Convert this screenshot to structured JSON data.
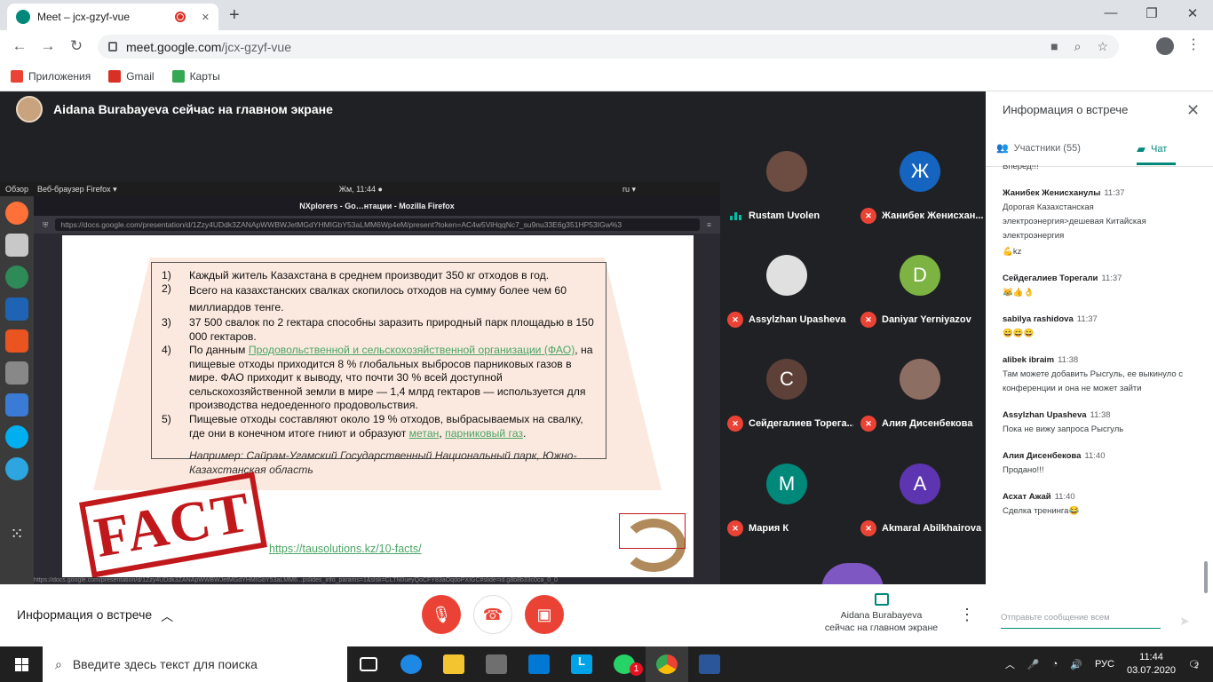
{
  "browser": {
    "tab_title": "Meet – jcx-gzyf-vue",
    "tab_close": "✕",
    "new_tab": "+",
    "url_domain": "meet.google.com",
    "url_path": "/jcx-gzyf-vue",
    "bookmarks": [
      {
        "label": "Приложения",
        "color": "#ea4335"
      },
      {
        "label": "Gmail",
        "color": "#d93025"
      },
      {
        "label": "Карты",
        "color": "#34a853"
      }
    ]
  },
  "meet": {
    "presenter_banner": "Aidana Burabayeva сейчас на главном экране",
    "info_button": "Информация о встрече",
    "presenting_line1": "Aidana Burabayeva",
    "presenting_line2": "сейчас на главном экране"
  },
  "shared_screen": {
    "gnome_overview": "Обзор",
    "gnome_app": "Веб-браузер Firefox ▾",
    "gnome_clock": "Жм, 11:44 ●",
    "gnome_lang": "ru ▾",
    "ff_title": "NXplorers - Go…нтации - Mozilla Firefox",
    "ff_url": "https://docs.google.com/presentation/d/1Zzy4UDdk3ZANApWWBWJetMGdYHMIGbY53aLMM6Wp4eM/present?token=AC4w5ViHqqNc7_su9nu33E6g351HP53IGw%3",
    "status_url": "https://docs.google.com/presentation/d/1Zzy4UDdk3ZANApWWBWJetMGdYHMIGbY53aLMM6...pslides_info_params=1&slsk=CLTN0ueyQoCFY83aOqdoPXIGC#slide=id.g8b8b33c0ca_0_0",
    "items": [
      {
        "n": "1)",
        "text": "Каждый житель Казахстана в среднем производит 350 кг отходов в год."
      },
      {
        "n": "2)",
        "text": "Всего на казахстанских свалках скопилось отходов на сумму более чем 60 миллиардов тенге."
      },
      {
        "n": "3)",
        "text": "37 500 свалок по 2 гектара способны заразить природный парк площадью в 150 000 гектаров."
      },
      {
        "n": "4)",
        "pre": "По данным ",
        "link": "Продовольственной и сельскохозяйственной организации (ФАО)",
        "post": ", на пищевые отходы приходится 8 % глобальных выбросов парниковых газов в мире. ФАО приходит к выводу, что почти 30 % всей доступной сельскохозяйственной земли в мире — 1,4 млрд гектаров — используется для производства недоеденного продовольствия."
      },
      {
        "n": "5)",
        "pre": "Пищевые отходы составляют около 19 % отходов, выбрасываемых на свалку, где они в конечном итоге гниют и образуют ",
        "link": "метан",
        "mid": ", ",
        "link2": "парниковый газ",
        "post": "."
      }
    ],
    "example_note": "Например: Сайрам-Угамский Государственный Национальный парк, Южно-Казахстанская область",
    "stamp_text": "FACT",
    "link": "https://tausolutions.kz/10-facts/"
  },
  "participants": [
    {
      "name": "Rustam Uvolen",
      "initial": "",
      "color": "#6d4c41",
      "speaking": true
    },
    {
      "name": "Жанибек Женисхан...",
      "initial": "Ж",
      "color": "#1565c0",
      "speaking": false
    },
    {
      "name": "Assylzhan Upasheva",
      "initial": "",
      "color": "#e0e0e0",
      "speaking": false
    },
    {
      "name": "Daniyar Yerniyazov",
      "initial": "D",
      "color": "#7cb342",
      "speaking": false
    },
    {
      "name": "Сейдегалиев Торега...",
      "initial": "С",
      "color": "#5d4037",
      "speaking": false
    },
    {
      "name": "Алия Дисенбекова",
      "initial": "",
      "color": "#8d6e63",
      "speaking": false
    },
    {
      "name": "Мария К",
      "initial": "М",
      "color": "#00897b",
      "speaking": false
    },
    {
      "name": "Akmaral Abilkhairova",
      "initial": "A",
      "color": "#5e35b1",
      "speaking": false
    }
  ],
  "panel": {
    "title": "Информация о встрече",
    "tab_people": "Участники (55)",
    "tab_chat": "Чат",
    "composer_placeholder": "Отправьте сообщение всем",
    "messages": [
      {
        "who": "",
        "time": "",
        "text": "Вперед!!!"
      },
      {
        "who": "Жанибек Женисханулы",
        "time": "11:37",
        "text": "Дорогая Казахстанская электроэнергия>дешевая Китайская электроэнергия"
      },
      {
        "who": "",
        "time": "",
        "text": "💪kz"
      },
      {
        "who": "Сейдегалиев Торегали",
        "time": "11:37",
        "text": "😹👍👌"
      },
      {
        "who": "sabilya rashidova",
        "time": "11:37",
        "text": "😄😄😄"
      },
      {
        "who": "alibek ibraim",
        "time": "11:38",
        "text": "Там можете добавить Рысгуль, ее выкинуло с конференции и она не может зайти"
      },
      {
        "who": "Assylzhan Upasheva",
        "time": "11:38",
        "text": "Пока не вижу запроса Рысгуль"
      },
      {
        "who": "Алия Дисенбекова",
        "time": "11:40",
        "text": "Продано!!!"
      },
      {
        "who": "Асхат Ажай",
        "time": "11:40",
        "text": "Сделка тренинга😂"
      }
    ]
  },
  "taskbar": {
    "search_placeholder": "Введите здесь текст для поиска",
    "lang": "РУС",
    "time": "11:44",
    "date": "03.07.2020",
    "notif_count": "2",
    "whatsapp_badge": "1"
  }
}
